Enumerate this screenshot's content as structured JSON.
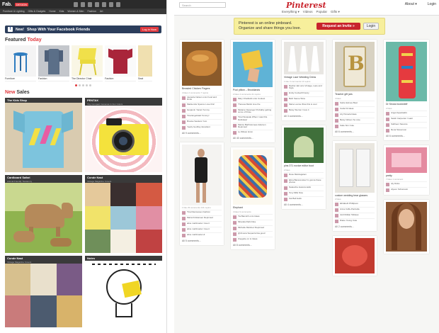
{
  "fab": {
    "logo": "Fab.",
    "badge": "DESIGN",
    "nav": [
      "Fab.",
      "Furniture & Lighting",
      "Gifts & Gadgets",
      "Home",
      "Kids",
      "Women & Men",
      "Fashion",
      "Art",
      "Vintage"
    ],
    "facebook": {
      "new": "New!",
      "message": "Shop With Your Facebook Friends",
      "button": "Log in Now"
    },
    "featured": {
      "title_a": "Featured",
      "title_b": "Today",
      "items": [
        "Furniture",
        "Fashion",
        "The Director Chair",
        "Fashion",
        "Seat"
      ]
    },
    "sales": {
      "title_a": "New",
      "title_b": "Sales",
      "items": [
        {
          "title": "The Kids Shop",
          "sub": ""
        },
        {
          "title": "PENTAX",
          "sub": "Tiny Compact Cameras In Fun Colors"
        },
        {
          "title": "Cardboard Safari",
          "sub": "Animal Friendly Taxidermy"
        },
        {
          "title": "Conde Nast",
          "sub": "Vintage Magazine Covers"
        },
        {
          "title": "Conde Nast",
          "sub": "Vintage Magazine Covers"
        },
        {
          "title": "Notes",
          "sub": ""
        }
      ]
    }
  },
  "pinterest": {
    "search_placeholder": "Search",
    "logo": "Pinterest",
    "menu": [
      "Everything ▾",
      "Videos",
      "Popular",
      "Gifts ▾"
    ],
    "about": "About ▾",
    "login": "Login",
    "invite": {
      "line1": "Pinterest is an online pinboard.",
      "line2": "Organize and share things you love.",
      "request": "Request an Invite »",
      "login": "Login"
    },
    "columns": [
      [
        {
          "cap": "Breaded Chicken Fingers",
          "stats": "4 likes 2 comments 7 repins",
          "comments": [
            "Jeanette Nelson onto Food and Drink",
            "Mackenzie Spence Love this!",
            "benjamin Yaniel Yummy",
            "Tina Engelstad Yummy!",
            "Brooke Sanders Yum",
            "Yearly Godfrey Excellent"
          ],
          "all": "All 9 comments..."
        },
        {
          "cap": "",
          "stats": "1 like 23 comments 141 repins",
          "comments": [
            "Tina Rasmussen fashion",
            "Maria Kristiansen Repinned",
            "aline marlinsaze I love it",
            "aline marlinsaze I love it",
            "aline marlinsaze Hi",
            "Gordon Eddeltanall Repinned"
          ],
          "all": "All 5 comments..."
        }
      ],
      [
        {
          "cap": "Pool pillow – Brooklands",
          "stats": "2 likes 4 comments 21 repins",
          "comments": [
            "Mary Chadwick onto Coolest",
            "Theresa Martin love the",
            "Melanie Oppenger Probably getting some of those",
            "Tina Pasquale When I saw this. Definitely!",
            "Marcie Bartholomew-Aderson Repinned",
            "Lu Wilson Hmm"
          ],
          "all": "All 40 comments..."
        },
        {
          "cap": "Elephant",
          "stats": "4 likes 9 comments",
          "comments": [
            "Tia Bamitch onto Ideas",
            "Miranda Pathi Nice",
            "Michelle Martinez Repinned",
            "@Jimena Sequeira lisa good",
            "Zoegette on to Ideas",
            "Smith LoveLife"
          ],
          "all": "All 8 comments..."
        }
      ],
      [
        {
          "cap": "Vintage Lace Wedding Dress",
          "stats": "1 like 3 comments 13 repins",
          "comments": [
            "Rachel Jatt onto Vintage, Lace and Style",
            "Emily Cockerill Fancy",
            "Beth Sauve Wow",
            "Marie Levine Wow this is cool",
            "Betsy Sterner I love it"
          ],
          "all": "All 3 comments..."
        },
        {
          "cap": "pins 371 novice editor boot",
          "stats": "2 likes",
          "comments": [
            "Rose Marciagulem",
            "Elma Baranovska I'm gonna these photos",
            "Natascha Jessica Hello",
            "Tony Mills Nice",
            "Kat Bell Hello"
          ],
          "all": "All 4 comments..."
        }
      ],
      [
        {
          "cap": "Teacher gift jars",
          "stats": "4 likes",
          "comments": [
            "Karla Holmes Best",
            "Carla Fit Ideas",
            "Lily Pamela Ideas",
            "Betsy Gibson So cute",
            "Katie Sim Cute"
          ],
          "all": "All 6 comments..."
        },
        {
          "cap": "custom wedding bear glasses",
          "stats": "2 likes",
          "comments": [
            "Elizabeth Phillipson",
            "Anna Coffe-Pantrelle",
            "Judi Mullan Tableau",
            "Diane Young Cute",
            "Kaci Forsberg"
          ],
          "all": "All 2 comments..."
        }
      ],
      [
        {
          "cap": "Dr Seuss bookshelf",
          "stats": "2 likes",
          "comments": [
            "Angel Appelsakis",
            "Sarah Carpenter I want",
            "Kathleen Sauvoie",
            "Rena Stevenson"
          ],
          "all": "All 6 comments..."
        },
        {
          "cap": "pretty",
          "stats": "7 likes 1 comment",
          "comments": [
            "Aly Dicks",
            "Alyson Schumann"
          ],
          "all": "All 1 comments..."
        }
      ]
    ]
  },
  "colors": {
    "fab_red": "#e0393e",
    "pin_red": "#c8232c"
  },
  "icons": [
    "search-icon",
    "facebook-icon",
    "arrow-right-icon"
  ]
}
